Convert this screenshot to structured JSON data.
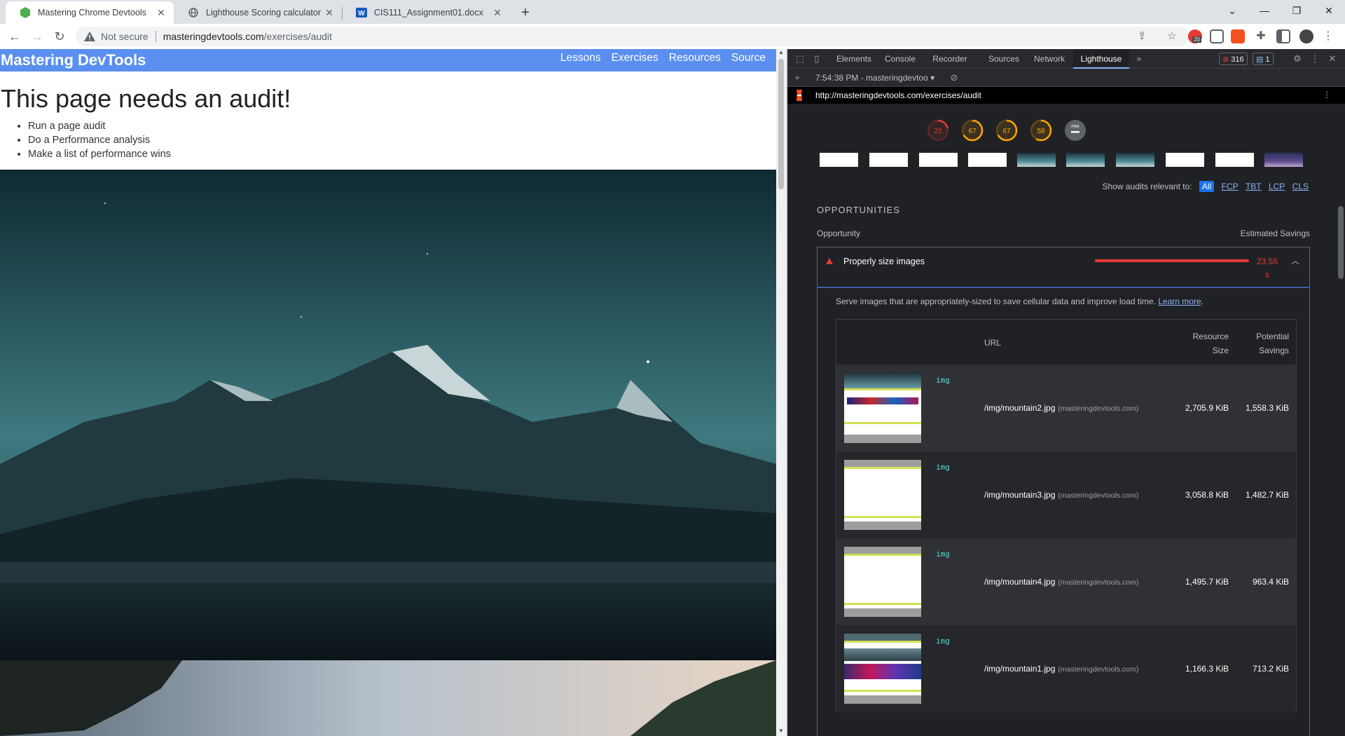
{
  "browser": {
    "tabs": [
      {
        "title": "Mastering Chrome Devtools",
        "active": true
      },
      {
        "title": "Lighthouse Scoring calculator",
        "active": false
      },
      {
        "title": "CIS111_Assignment01.docx",
        "active": false
      }
    ],
    "omnibox": {
      "security": "Not secure",
      "host": "masteringdevtools.com",
      "path": "/exercises/audit"
    },
    "extension_badge": "20"
  },
  "page": {
    "site_title": "Mastering DevTools",
    "nav": [
      "Lessons",
      "Exercises",
      "Resources",
      "Source"
    ],
    "heading": "This page needs an audit!",
    "list": [
      "Run a page audit",
      "Do a Performance analysis",
      "Make a list of performance wins"
    ]
  },
  "devtools": {
    "tabs": [
      "Elements",
      "Console",
      "Recorder",
      "Sources",
      "Network",
      "Lighthouse"
    ],
    "active_tab": "Lighthouse",
    "error_count": "316",
    "message_count": "1",
    "report_selector": "7:54:38 PM - masteringdevtoo",
    "report_url": "http://masteringdevtools.com/exercises/audit",
    "scores": [
      {
        "value": "22",
        "color": "#e53935"
      },
      {
        "value": "67",
        "color": "#ffa400"
      },
      {
        "value": "67",
        "color": "#ffa400"
      },
      {
        "value": "58",
        "color": "#ffa400"
      }
    ],
    "pwa_label": "PWA",
    "filter": {
      "label": "Show audits relevant to:",
      "chips": [
        "All",
        "FCP",
        "TBT",
        "LCP",
        "CLS"
      ]
    },
    "section_title": "OPPORTUNITIES",
    "col_opportunity": "Opportunity",
    "col_savings": "Estimated Savings",
    "audit": {
      "title": "Properly size images",
      "savings_value": "23.55",
      "savings_unit": "s",
      "description": "Serve images that are appropriately-sized to save cellular data and improve load time.",
      "learn_more": "Learn more",
      "headers": {
        "url": "URL",
        "resource_1": "Resource",
        "resource_2": "Size",
        "potential_1": "Potential",
        "potential_2": "Savings"
      },
      "rows": [
        {
          "tag": "img",
          "path": "/img/mountain2.jpg",
          "host": "(masteringdevtools.com)",
          "size": "2,705.9 KiB",
          "savings": "1,558.3 KiB"
        },
        {
          "tag": "img",
          "path": "/img/mountain3.jpg",
          "host": "(masteringdevtools.com)",
          "size": "3,058.8 KiB",
          "savings": "1,482.7 KiB"
        },
        {
          "tag": "img",
          "path": "/img/mountain4.jpg",
          "host": "(masteringdevtools.com)",
          "size": "1,495.7 KiB",
          "savings": "963.4 KiB"
        },
        {
          "tag": "img",
          "path": "/img/mountain1.jpg",
          "host": "(masteringdevtools.com)",
          "size": "1,166.3 KiB",
          "savings": "713.2 KiB"
        }
      ]
    }
  },
  "colors": {
    "site_header": "#5a8ff0",
    "fail": "#e53935",
    "average": "#ffa400",
    "link": "#8ab4f8"
  }
}
